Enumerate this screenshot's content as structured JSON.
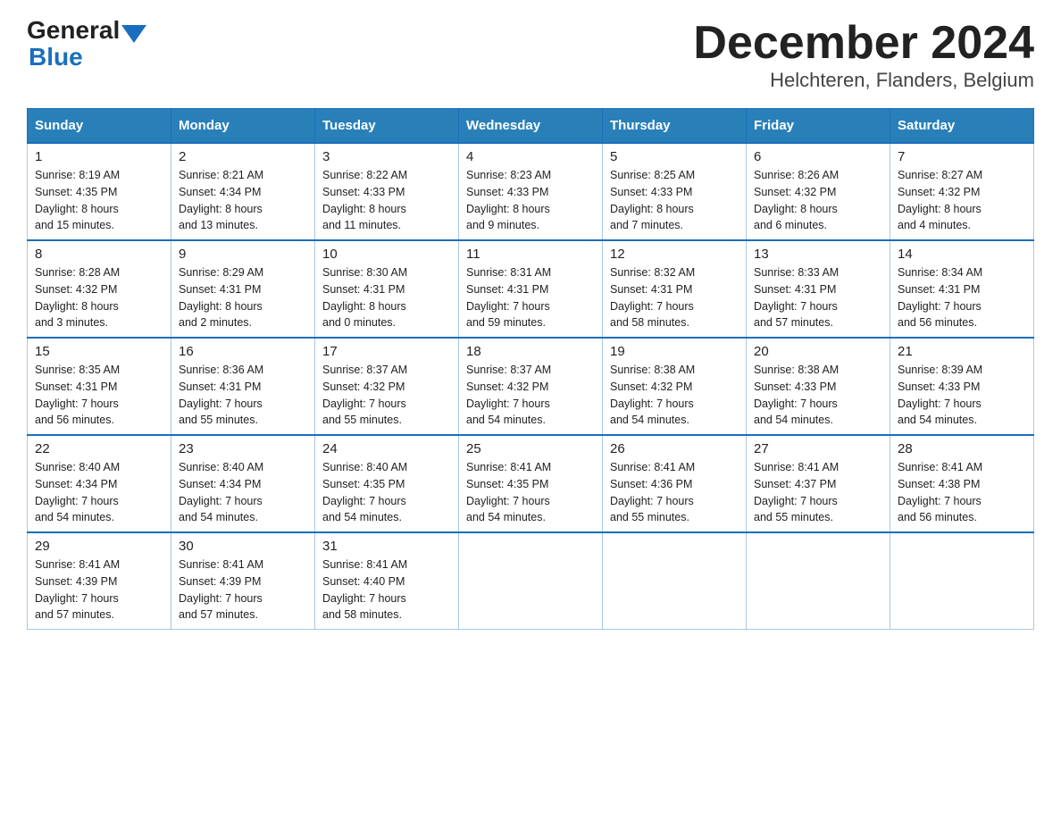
{
  "logo": {
    "general": "General",
    "blue": "Blue"
  },
  "title": "December 2024",
  "subtitle": "Helchteren, Flanders, Belgium",
  "headers": [
    "Sunday",
    "Monday",
    "Tuesday",
    "Wednesday",
    "Thursday",
    "Friday",
    "Saturday"
  ],
  "weeks": [
    [
      {
        "day": "1",
        "info": "Sunrise: 8:19 AM\nSunset: 4:35 PM\nDaylight: 8 hours\nand 15 minutes."
      },
      {
        "day": "2",
        "info": "Sunrise: 8:21 AM\nSunset: 4:34 PM\nDaylight: 8 hours\nand 13 minutes."
      },
      {
        "day": "3",
        "info": "Sunrise: 8:22 AM\nSunset: 4:33 PM\nDaylight: 8 hours\nand 11 minutes."
      },
      {
        "day": "4",
        "info": "Sunrise: 8:23 AM\nSunset: 4:33 PM\nDaylight: 8 hours\nand 9 minutes."
      },
      {
        "day": "5",
        "info": "Sunrise: 8:25 AM\nSunset: 4:33 PM\nDaylight: 8 hours\nand 7 minutes."
      },
      {
        "day": "6",
        "info": "Sunrise: 8:26 AM\nSunset: 4:32 PM\nDaylight: 8 hours\nand 6 minutes."
      },
      {
        "day": "7",
        "info": "Sunrise: 8:27 AM\nSunset: 4:32 PM\nDaylight: 8 hours\nand 4 minutes."
      }
    ],
    [
      {
        "day": "8",
        "info": "Sunrise: 8:28 AM\nSunset: 4:32 PM\nDaylight: 8 hours\nand 3 minutes."
      },
      {
        "day": "9",
        "info": "Sunrise: 8:29 AM\nSunset: 4:31 PM\nDaylight: 8 hours\nand 2 minutes."
      },
      {
        "day": "10",
        "info": "Sunrise: 8:30 AM\nSunset: 4:31 PM\nDaylight: 8 hours\nand 0 minutes."
      },
      {
        "day": "11",
        "info": "Sunrise: 8:31 AM\nSunset: 4:31 PM\nDaylight: 7 hours\nand 59 minutes."
      },
      {
        "day": "12",
        "info": "Sunrise: 8:32 AM\nSunset: 4:31 PM\nDaylight: 7 hours\nand 58 minutes."
      },
      {
        "day": "13",
        "info": "Sunrise: 8:33 AM\nSunset: 4:31 PM\nDaylight: 7 hours\nand 57 minutes."
      },
      {
        "day": "14",
        "info": "Sunrise: 8:34 AM\nSunset: 4:31 PM\nDaylight: 7 hours\nand 56 minutes."
      }
    ],
    [
      {
        "day": "15",
        "info": "Sunrise: 8:35 AM\nSunset: 4:31 PM\nDaylight: 7 hours\nand 56 minutes."
      },
      {
        "day": "16",
        "info": "Sunrise: 8:36 AM\nSunset: 4:31 PM\nDaylight: 7 hours\nand 55 minutes."
      },
      {
        "day": "17",
        "info": "Sunrise: 8:37 AM\nSunset: 4:32 PM\nDaylight: 7 hours\nand 55 minutes."
      },
      {
        "day": "18",
        "info": "Sunrise: 8:37 AM\nSunset: 4:32 PM\nDaylight: 7 hours\nand 54 minutes."
      },
      {
        "day": "19",
        "info": "Sunrise: 8:38 AM\nSunset: 4:32 PM\nDaylight: 7 hours\nand 54 minutes."
      },
      {
        "day": "20",
        "info": "Sunrise: 8:38 AM\nSunset: 4:33 PM\nDaylight: 7 hours\nand 54 minutes."
      },
      {
        "day": "21",
        "info": "Sunrise: 8:39 AM\nSunset: 4:33 PM\nDaylight: 7 hours\nand 54 minutes."
      }
    ],
    [
      {
        "day": "22",
        "info": "Sunrise: 8:40 AM\nSunset: 4:34 PM\nDaylight: 7 hours\nand 54 minutes."
      },
      {
        "day": "23",
        "info": "Sunrise: 8:40 AM\nSunset: 4:34 PM\nDaylight: 7 hours\nand 54 minutes."
      },
      {
        "day": "24",
        "info": "Sunrise: 8:40 AM\nSunset: 4:35 PM\nDaylight: 7 hours\nand 54 minutes."
      },
      {
        "day": "25",
        "info": "Sunrise: 8:41 AM\nSunset: 4:35 PM\nDaylight: 7 hours\nand 54 minutes."
      },
      {
        "day": "26",
        "info": "Sunrise: 8:41 AM\nSunset: 4:36 PM\nDaylight: 7 hours\nand 55 minutes."
      },
      {
        "day": "27",
        "info": "Sunrise: 8:41 AM\nSunset: 4:37 PM\nDaylight: 7 hours\nand 55 minutes."
      },
      {
        "day": "28",
        "info": "Sunrise: 8:41 AM\nSunset: 4:38 PM\nDaylight: 7 hours\nand 56 minutes."
      }
    ],
    [
      {
        "day": "29",
        "info": "Sunrise: 8:41 AM\nSunset: 4:39 PM\nDaylight: 7 hours\nand 57 minutes."
      },
      {
        "day": "30",
        "info": "Sunrise: 8:41 AM\nSunset: 4:39 PM\nDaylight: 7 hours\nand 57 minutes."
      },
      {
        "day": "31",
        "info": "Sunrise: 8:41 AM\nSunset: 4:40 PM\nDaylight: 7 hours\nand 58 minutes."
      },
      {
        "day": "",
        "info": ""
      },
      {
        "day": "",
        "info": ""
      },
      {
        "day": "",
        "info": ""
      },
      {
        "day": "",
        "info": ""
      }
    ]
  ]
}
